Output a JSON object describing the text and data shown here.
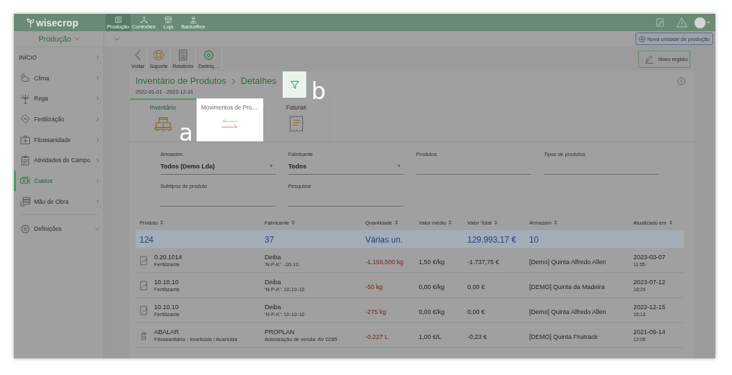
{
  "top_bar": {
    "logo": "wisecrop",
    "nav": [
      {
        "label": "Produção",
        "selected": true
      },
      {
        "label": "Conexões",
        "selected": false
      },
      {
        "label": "Loja",
        "selected": false
      },
      {
        "label": "Backoffice",
        "selected": false
      }
    ]
  },
  "sub_bar": {
    "unit_selector": "Produção",
    "new_unit_button": "Nova unidade de produção"
  },
  "sidebar": {
    "items": [
      {
        "kind": "heading",
        "label": "INÍCIO",
        "selected": false
      },
      {
        "kind": "link",
        "label": "Clima",
        "selected": false
      },
      {
        "kind": "link",
        "label": "Rega",
        "selected": false
      },
      {
        "kind": "link",
        "label": "Fertilização",
        "selected": false
      },
      {
        "kind": "link",
        "label": "Fitossanidade",
        "selected": false
      },
      {
        "kind": "link",
        "label": "Atividades de Campo",
        "selected": false
      },
      {
        "kind": "link",
        "label": "Custos",
        "selected": true
      },
      {
        "kind": "link",
        "label": "Mão de Obra",
        "selected": false
      },
      {
        "kind": "group",
        "label": "Definições",
        "selected": false
      }
    ]
  },
  "toolbar": {
    "buttons": [
      {
        "label": "Voltar"
      },
      {
        "label": "Suporte"
      },
      {
        "label": "Relatório"
      },
      {
        "label": "Definiç…"
      }
    ],
    "new_record_button": "Novo registo"
  },
  "card": {
    "title": "Inventário de Produtos",
    "current": "Detalhes",
    "date_range": "2022-01-01 - 2022-12-31",
    "filter_button": {
      "highlighted": true,
      "callout": "b"
    },
    "tabs": [
      {
        "label": "Inventário",
        "selected": true,
        "highlighted": false
      },
      {
        "label": "Movimentos de Pro…",
        "selected": false,
        "highlighted": true,
        "callout": "a"
      },
      {
        "label": "Faturas",
        "selected": false,
        "highlighted": false
      }
    ],
    "filters": [
      {
        "kind": "select",
        "label": "Armazém",
        "value": "Todos (Demo Lda)"
      },
      {
        "kind": "select",
        "label": "Fabricante",
        "value": "Todos"
      },
      {
        "kind": "text",
        "label": "Produtos"
      },
      {
        "kind": "text",
        "label": "Tipos de produtos"
      },
      {
        "kind": "text",
        "label": "Subtipos de produto"
      },
      {
        "kind": "text",
        "label": "Pesquisar"
      }
    ]
  },
  "table": {
    "columns": [
      "Produto",
      "Fabricante",
      "Quantidade",
      "Valor médio",
      "Valor Total",
      "Armazém",
      "Atualizado em"
    ],
    "summary": {
      "product": "124",
      "manufacturer": "37",
      "quantity": "Várias un.",
      "total_value": "129.993,17 €",
      "warehouse": "10"
    },
    "rows": [
      {
        "kind": "fertilizer",
        "product": "0.20.1014",
        "product_type": "Fertilizante",
        "manufacturer": "Deiba",
        "manufacturer_detail": "'N-P-K': -20-10",
        "quantity": "-1.158,500 kg",
        "avg_value": "1,50 €/kg",
        "total_value": "-1.737,75 €",
        "warehouse": "[Demo] Quinta Alfredo Allen",
        "date": "2023-03-07",
        "time": "11:55"
      },
      {
        "kind": "fertilizer",
        "product": "10.10.10",
        "product_type": "Fertilizante",
        "manufacturer": "Deiba",
        "manufacturer_detail": "'N-P-K': 10-10-10",
        "quantity": "-50 kg",
        "avg_value": "0,00 €/kg",
        "total_value": "0,00 €",
        "warehouse": "[DEMO] Quinta da Madeira",
        "date": "2023-07-12",
        "time": "18:29"
      },
      {
        "kind": "fertilizer",
        "product": "10.10.10",
        "product_type": "Fertilizante",
        "manufacturer": "Deiba",
        "manufacturer_detail": "'N-P-K': 10-10-10",
        "quantity": "-275 kg",
        "avg_value": "0,00 €/kg",
        "total_value": "0,00 €",
        "warehouse": "[Demo] Quinta Alfredo Allen",
        "date": "2022-12-15",
        "time": "15:13"
      },
      {
        "kind": "phytosanitary",
        "product": "ABALAR",
        "product_type": "Fitossanitário · Inseticida / Acaricida",
        "manufacturer": "PROPLAN",
        "manufacturer_detail": "Autorização de venda: AV 0285",
        "quantity": "-0,227 L",
        "avg_value": "1,00 €/L",
        "total_value": "-0,23 €",
        "warehouse": "[DEMO] Quinta Fruitrack",
        "date": "2021-09-14",
        "time": "12:05"
      }
    ]
  }
}
